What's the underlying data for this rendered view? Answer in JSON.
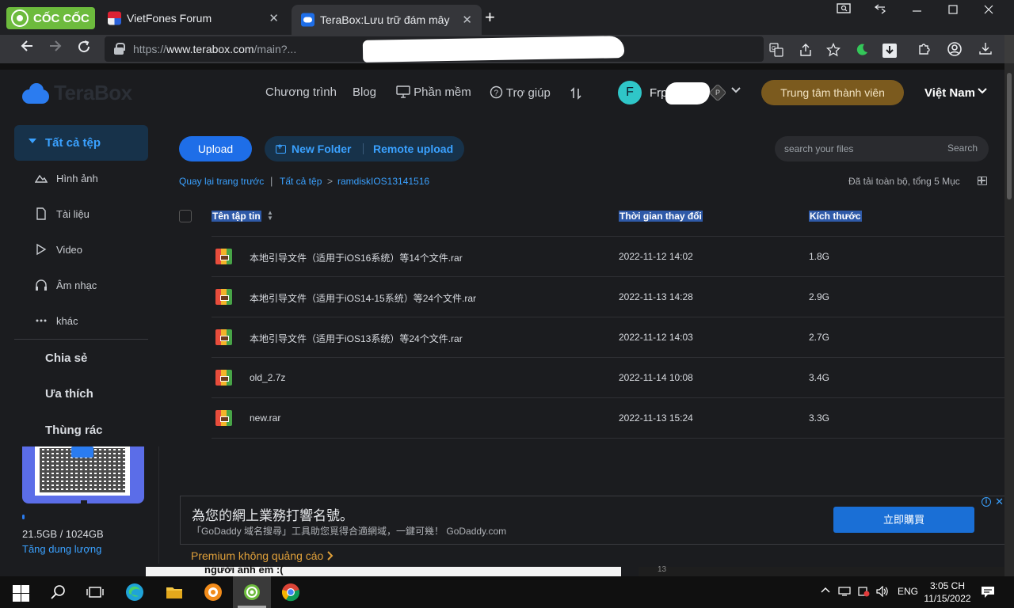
{
  "browser": {
    "brand": "CỐC CỐC",
    "tabs": [
      {
        "title": "VietFones Forum",
        "active": false
      },
      {
        "title": "TeraBox:Lưu trữ đám mây",
        "active": true
      }
    ],
    "address": {
      "scheme": "https://",
      "host": "www.terabox.com",
      "path": "/main?..."
    },
    "accent_color": "#6dbb3d"
  },
  "header": {
    "logo": "TeraBox",
    "nav": [
      "Chương trình",
      "Blog",
      "Phần mềm",
      "Trợ giúp"
    ],
    "user_initial": "F",
    "user_name": "Frp",
    "badge": "P",
    "member_button": "Trung tâm thành viên",
    "region": "Việt Nam"
  },
  "sidebar": {
    "active": "Tất cả tệp",
    "items": [
      {
        "label": "Hình ảnh",
        "icon": "image-icon"
      },
      {
        "label": "Tài liệu",
        "icon": "document-icon"
      },
      {
        "label": "Video",
        "icon": "play-icon"
      },
      {
        "label": "Âm nhạc",
        "icon": "headphones-icon"
      },
      {
        "label": "khác",
        "icon": "more-icon"
      }
    ],
    "sections": [
      "Chia sẻ",
      "Ưa thích",
      "Thùng rác"
    ],
    "storage": {
      "text": "21.5GB / 1024GB",
      "used_fraction": 0.021,
      "link": "Tăng dung lượng"
    }
  },
  "toolbar": {
    "upload": "Upload",
    "new_folder": "New Folder",
    "remote_upload": "Remote upload",
    "search_placeholder": "search your files",
    "search_button": "Search"
  },
  "breadcrumb": {
    "back": "Quay lại trang trước",
    "root": "Tất cả tệp",
    "current": "ramdiskIOS13141516",
    "status": "Đã tải toàn bộ, tổng 5 Mục"
  },
  "table": {
    "columns": [
      "Tên tập tin",
      "Thời gian thay đổi",
      "Kích thước"
    ],
    "rows": [
      {
        "name": "本地引导文件（适用于iOS16系统）等14个文件.rar",
        "modified": "2022-11-12 14:02",
        "size": "1.8G"
      },
      {
        "name": "本地引导文件（适用于iOS14-15系统）等24个文件.rar",
        "modified": "2022-11-13 14:28",
        "size": "2.9G"
      },
      {
        "name": "本地引导文件（适用于iOS13系统）等24个文件.rar",
        "modified": "2022-11-12 14:03",
        "size": "2.7G"
      },
      {
        "name": "old_2.7z",
        "modified": "2022-11-14 10:08",
        "size": "3.4G"
      },
      {
        "name": "new.rar",
        "modified": "2022-11-13 15:24",
        "size": "3.3G"
      }
    ]
  },
  "ad": {
    "headline": "為您的網上業務打響名號。",
    "subline": "「GoDaddy 域名搜尋」工具助您覓得合適網域，一鍵可幾！ GoDaddy.com",
    "button": "立即購買",
    "premium": "Premium không quảng cáo"
  },
  "underlay": {
    "peek_text": "người anh em :(",
    "number": "13"
  },
  "taskbar": {
    "language": "ENG",
    "time": "3:05 CH",
    "date": "11/15/2022"
  }
}
